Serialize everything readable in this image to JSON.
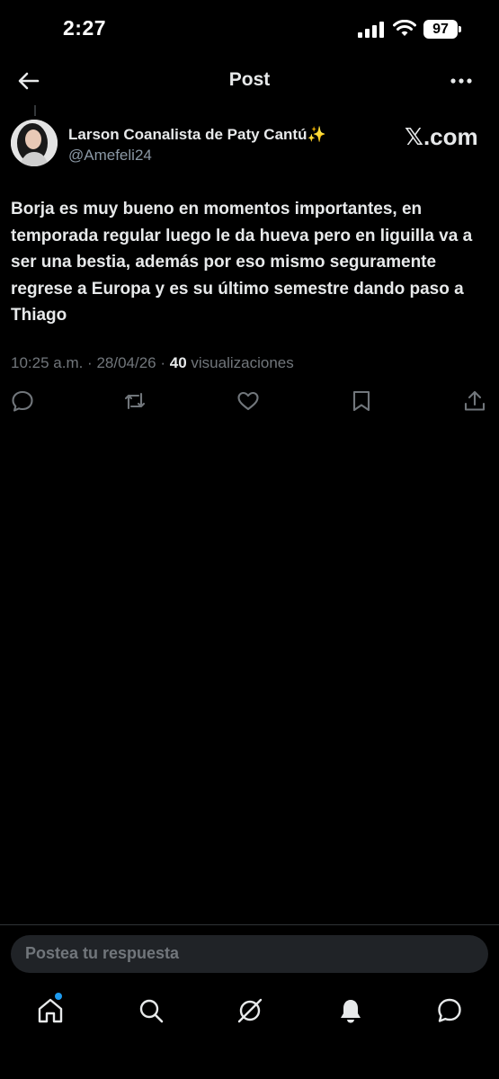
{
  "status_bar": {
    "time": "2:27",
    "battery": "97"
  },
  "header": {
    "title": "Post"
  },
  "post": {
    "author_name": "Larson Coanalista de Paty Cantú✨",
    "handle": "@Amefeli24",
    "brand": "𝕏.com",
    "text": "Borja es muy bueno en momentos importantes, en temporada regular luego le da hueva pero en liguilla va a ser una bestia, además por eso mismo seguramente regrese a Europa y es su último semestre dando paso a Thiago",
    "time": "10:25 a.m.",
    "date": "28/04/26",
    "views_count": "40",
    "views_label": "visualizaciones"
  },
  "reply": {
    "placeholder": "Postea tu respuesta"
  },
  "icons": {
    "back": "arrow-left-icon",
    "more": "more-icon",
    "reply": "reply-icon",
    "repost": "repost-icon",
    "like": "heart-icon",
    "bookmark": "bookmark-icon",
    "share": "share-icon",
    "home": "home-icon",
    "search": "search-icon",
    "grok": "grok-icon",
    "notifications": "bell-icon",
    "messages": "messages-icon"
  },
  "colors": {
    "background": "#000000",
    "text": "#e7e9ea",
    "muted": "#71767b",
    "accent": "#1d9bf0"
  }
}
